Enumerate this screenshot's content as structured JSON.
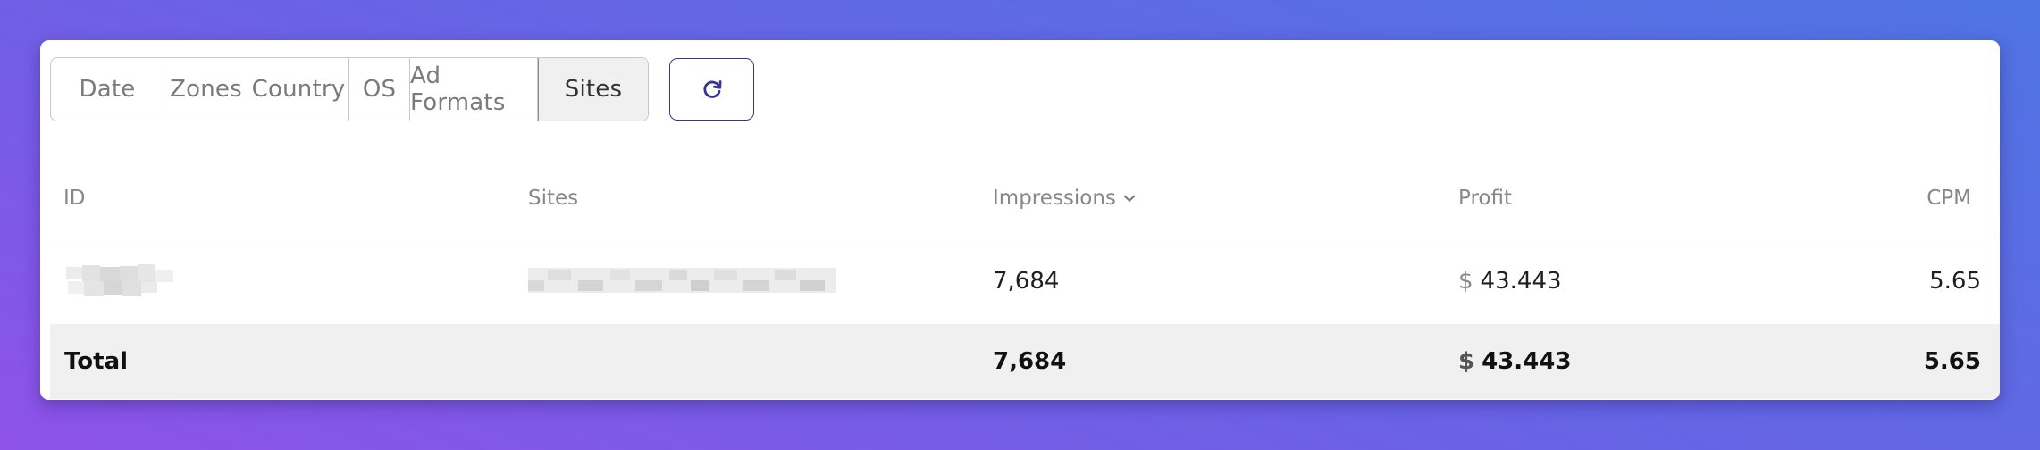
{
  "tabs": [
    {
      "label": "Date",
      "active": false
    },
    {
      "label": "Zones",
      "active": false
    },
    {
      "label": "Country",
      "active": false
    },
    {
      "label": "OS",
      "active": false
    },
    {
      "label": "Ad Formats",
      "active": false
    },
    {
      "label": "Sites",
      "active": true
    }
  ],
  "refresh_icon": "refresh-icon",
  "accent_color": "#3a3394",
  "table": {
    "columns": [
      "ID",
      "Sites",
      "Impressions",
      "Profit",
      "CPM"
    ],
    "sort_indicator_icon": "chevron-down-icon",
    "sorted_column": "Impressions",
    "rows": [
      {
        "id": "",
        "site": "",
        "impressions": "7,684",
        "profit_currency": "$",
        "profit": "43.443",
        "cpm": "5.65"
      }
    ],
    "total": {
      "label": "Total",
      "impressions": "7,684",
      "profit_currency": "$",
      "profit": "43.443",
      "cpm": "5.65"
    }
  }
}
